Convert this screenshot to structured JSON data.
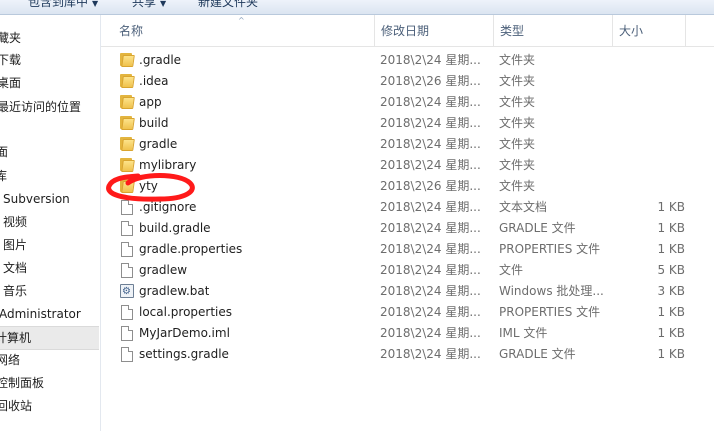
{
  "toolbar": {
    "include_label": "包含到库中",
    "share_label": "共享",
    "new_folder_label": "新建文件夹"
  },
  "sidebar": {
    "items": [
      {
        "label": "藏夹"
      },
      {
        "label": "下载"
      },
      {
        "label": "桌面"
      },
      {
        "label": "最近访问的位置"
      },
      {
        "label": "面"
      },
      {
        "label": "库"
      },
      {
        "label": "Subversion"
      },
      {
        "label": "视频"
      },
      {
        "label": "图片"
      },
      {
        "label": "文档"
      },
      {
        "label": "音乐"
      },
      {
        "label": "Administrator"
      },
      {
        "label": "计算机"
      },
      {
        "label": "网络"
      },
      {
        "label": "控制面板"
      },
      {
        "label": "回收站"
      }
    ]
  },
  "columns": {
    "name": "名称",
    "date": "修改日期",
    "type": "类型",
    "size": "大小"
  },
  "files": [
    {
      "name": ".gradle",
      "date": "2018\\2\\24 星期...",
      "type": "文件夹",
      "size": "",
      "icon": "folder"
    },
    {
      "name": ".idea",
      "date": "2018\\2\\26 星期...",
      "type": "文件夹",
      "size": "",
      "icon": "folder"
    },
    {
      "name": "app",
      "date": "2018\\2\\24 星期...",
      "type": "文件夹",
      "size": "",
      "icon": "folder"
    },
    {
      "name": "build",
      "date": "2018\\2\\24 星期...",
      "type": "文件夹",
      "size": "",
      "icon": "folder"
    },
    {
      "name": "gradle",
      "date": "2018\\2\\24 星期...",
      "type": "文件夹",
      "size": "",
      "icon": "folder"
    },
    {
      "name": "mylibrary",
      "date": "2018\\2\\24 星期...",
      "type": "文件夹",
      "size": "",
      "icon": "folder"
    },
    {
      "name": "yty",
      "date": "2018\\2\\26 星期...",
      "type": "文件夹",
      "size": "",
      "icon": "folder"
    },
    {
      "name": ".gitignore",
      "date": "2018\\2\\24 星期...",
      "type": "文本文档",
      "size": "1 KB",
      "icon": "file"
    },
    {
      "name": "build.gradle",
      "date": "2018\\2\\24 星期...",
      "type": "GRADLE 文件",
      "size": "1 KB",
      "icon": "file"
    },
    {
      "name": "gradle.properties",
      "date": "2018\\2\\24 星期...",
      "type": "PROPERTIES 文件",
      "size": "1 KB",
      "icon": "file"
    },
    {
      "name": "gradlew",
      "date": "2018\\2\\24 星期...",
      "type": "文件",
      "size": "5 KB",
      "icon": "file"
    },
    {
      "name": "gradlew.bat",
      "date": "2018\\2\\24 星期...",
      "type": "Windows 批处理...",
      "size": "3 KB",
      "icon": "bat"
    },
    {
      "name": "local.properties",
      "date": "2018\\2\\24 星期...",
      "type": "PROPERTIES 文件",
      "size": "1 KB",
      "icon": "file"
    },
    {
      "name": "MyJarDemo.iml",
      "date": "2018\\2\\24 星期...",
      "type": "IML 文件",
      "size": "1 KB",
      "icon": "file"
    },
    {
      "name": "settings.gradle",
      "date": "2018\\2\\24 星期...",
      "type": "GRADLE 文件",
      "size": "1 KB",
      "icon": "file"
    }
  ],
  "annotation": {
    "color": "#ff1a1a",
    "shape": "hand-drawn-ellipse"
  }
}
